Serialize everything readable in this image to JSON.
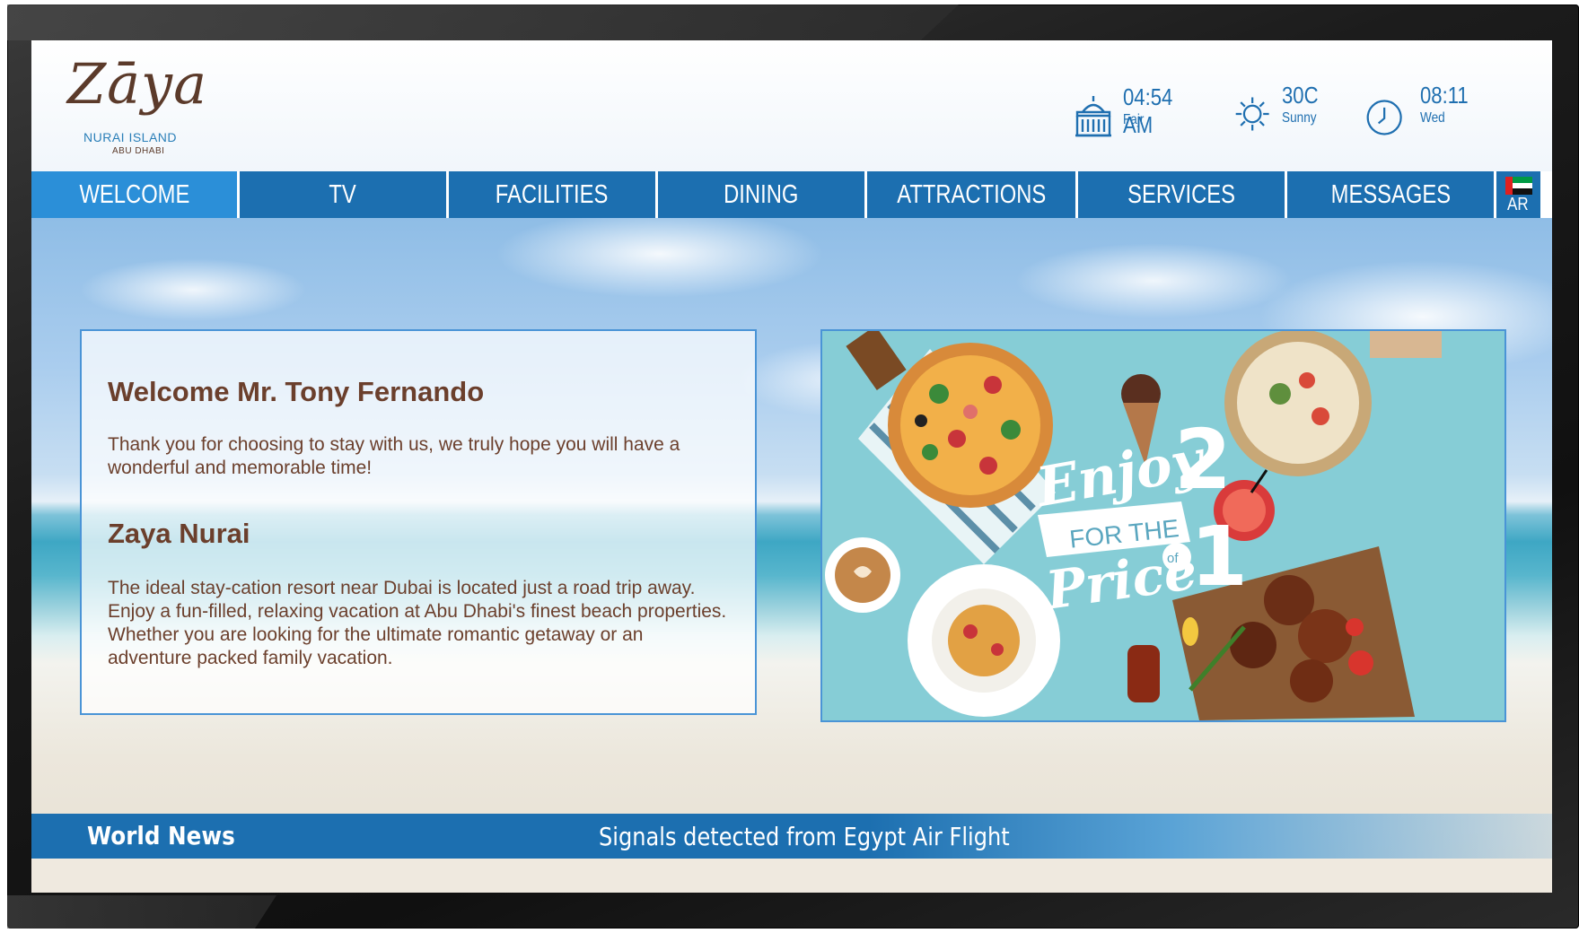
{
  "brand": {
    "logo_word": "Zāya",
    "logo_sub": "NURAI ISLAND",
    "logo_sub2": "ABU DHABI",
    "brown": "#6b3f2c",
    "blue": "#1c6fb0"
  },
  "header": {
    "prayer": {
      "time": "04:54 AM",
      "name": "Fajr",
      "icon": "mosque-icon"
    },
    "weather": {
      "temp": "30C",
      "condition": "Sunny",
      "icon": "sun-icon"
    },
    "clock": {
      "time": "08:11",
      "day": "Wed",
      "icon": "clock-icon"
    }
  },
  "nav": {
    "items": [
      {
        "label": "WELCOME",
        "active": true
      },
      {
        "label": "TV"
      },
      {
        "label": "FACILITIES"
      },
      {
        "label": "DINING"
      },
      {
        "label": "ATTRACTIONS"
      },
      {
        "label": "SERVICES"
      },
      {
        "label": "MESSAGES"
      }
    ],
    "language": {
      "label": "AR",
      "icon": "uae-flag-icon"
    }
  },
  "welcome": {
    "greeting": "Welcome Mr. Tony Fernando",
    "message": "Thank you for choosing to stay with us, we truly hope you will have a wonderful and memorable time!",
    "resort_title": "Zaya Nurai",
    "resort_description": "The ideal stay-cation resort near Dubai is located just a road trip away. Enjoy a fun-filled, relaxing vacation at Abu Dhabi's finest beach properties. Whether you are looking for the ultimate romantic getaway or an adventure packed family vacation."
  },
  "promo": {
    "line1": "Enjoy",
    "number1": "2",
    "line2": "FOR THE",
    "line3": "Price",
    "of": "of",
    "number2": "1"
  },
  "ticker": {
    "label": "World News",
    "headline": "Signals detected from Egypt Air Flight"
  }
}
